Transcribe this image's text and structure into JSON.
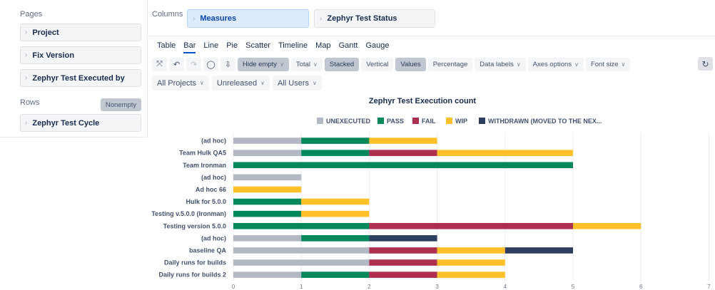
{
  "left": {
    "pages_label": "Pages",
    "pages": [
      "Project",
      "Fix Version",
      "Zephyr Test Executed by"
    ],
    "rows_label": "Rows",
    "nonempty_label": "Nonempty",
    "rows": [
      "Zephyr Test Cycle"
    ]
  },
  "columns": {
    "label": "Columns",
    "items": [
      "Measures",
      "Zephyr Test Status"
    ]
  },
  "tabs": [
    "Table",
    "Bar",
    "Line",
    "Pie",
    "Scatter",
    "Timeline",
    "Map",
    "Gantt",
    "Gauge"
  ],
  "active_tab": "Bar",
  "toolbar": {
    "hide_empty": "Hide empty",
    "total": "Total",
    "stacked": "Stacked",
    "vertical": "Vertical",
    "values": "Values",
    "percentage": "Percentage",
    "data_labels": "Data labels",
    "axes_options": "Axes options",
    "font_size": "Font size"
  },
  "icons": {
    "fullscreen": "fullscreen-icon",
    "undo": "undo-icon",
    "redo": "redo-icon",
    "comment": "comment-icon",
    "download": "download-icon",
    "refresh": "refresh-icon"
  },
  "filters": [
    "All Projects",
    "Unreleased",
    "All Users"
  ],
  "chart_data": {
    "type": "bar",
    "orientation": "horizontal",
    "stacked": true,
    "title": "Zephyr Test Execution count",
    "legend_position": "top",
    "grid": true,
    "xlim": [
      0,
      7
    ],
    "xticks": [
      0,
      1,
      2,
      3,
      4,
      5,
      6,
      7
    ],
    "categories": [
      "(ad hoc)",
      "Team Hulk QA5",
      "Team Ironman",
      "(ad hoc)",
      "Ad hoc 66",
      "Hulk for 5.0.0",
      "Testing v.5.0.0 (Ironman)",
      "Testing version 5.0.0",
      "(ad hoc)",
      "baseline QA",
      "Daily runs for builds",
      "Daily runs for builds 2"
    ],
    "series": [
      {
        "name": "UNEXECUTED",
        "color": "#b3b9c4",
        "values": [
          1,
          1,
          0,
          1,
          0,
          0,
          0,
          0,
          1,
          2,
          2,
          1
        ]
      },
      {
        "name": "PASS",
        "color": "#00875a",
        "values": [
          1,
          1,
          5,
          0,
          0,
          1,
          1,
          2,
          1,
          0,
          0,
          1
        ]
      },
      {
        "name": "FAIL",
        "color": "#ae2e4f",
        "values": [
          0,
          1,
          0,
          0,
          0,
          0,
          0,
          3,
          0,
          1,
          1,
          1
        ]
      },
      {
        "name": "WIP",
        "color": "#ffc02a",
        "values": [
          1,
          2,
          0,
          0,
          1,
          1,
          1,
          1,
          0,
          1,
          1,
          1
        ]
      },
      {
        "name": "WITHDRAWN (MOVED TO THE NEX...",
        "color": "#2e3e5f",
        "values": [
          0,
          0,
          0,
          0,
          0,
          0,
          0,
          0,
          1,
          1,
          0,
          0
        ]
      }
    ]
  }
}
